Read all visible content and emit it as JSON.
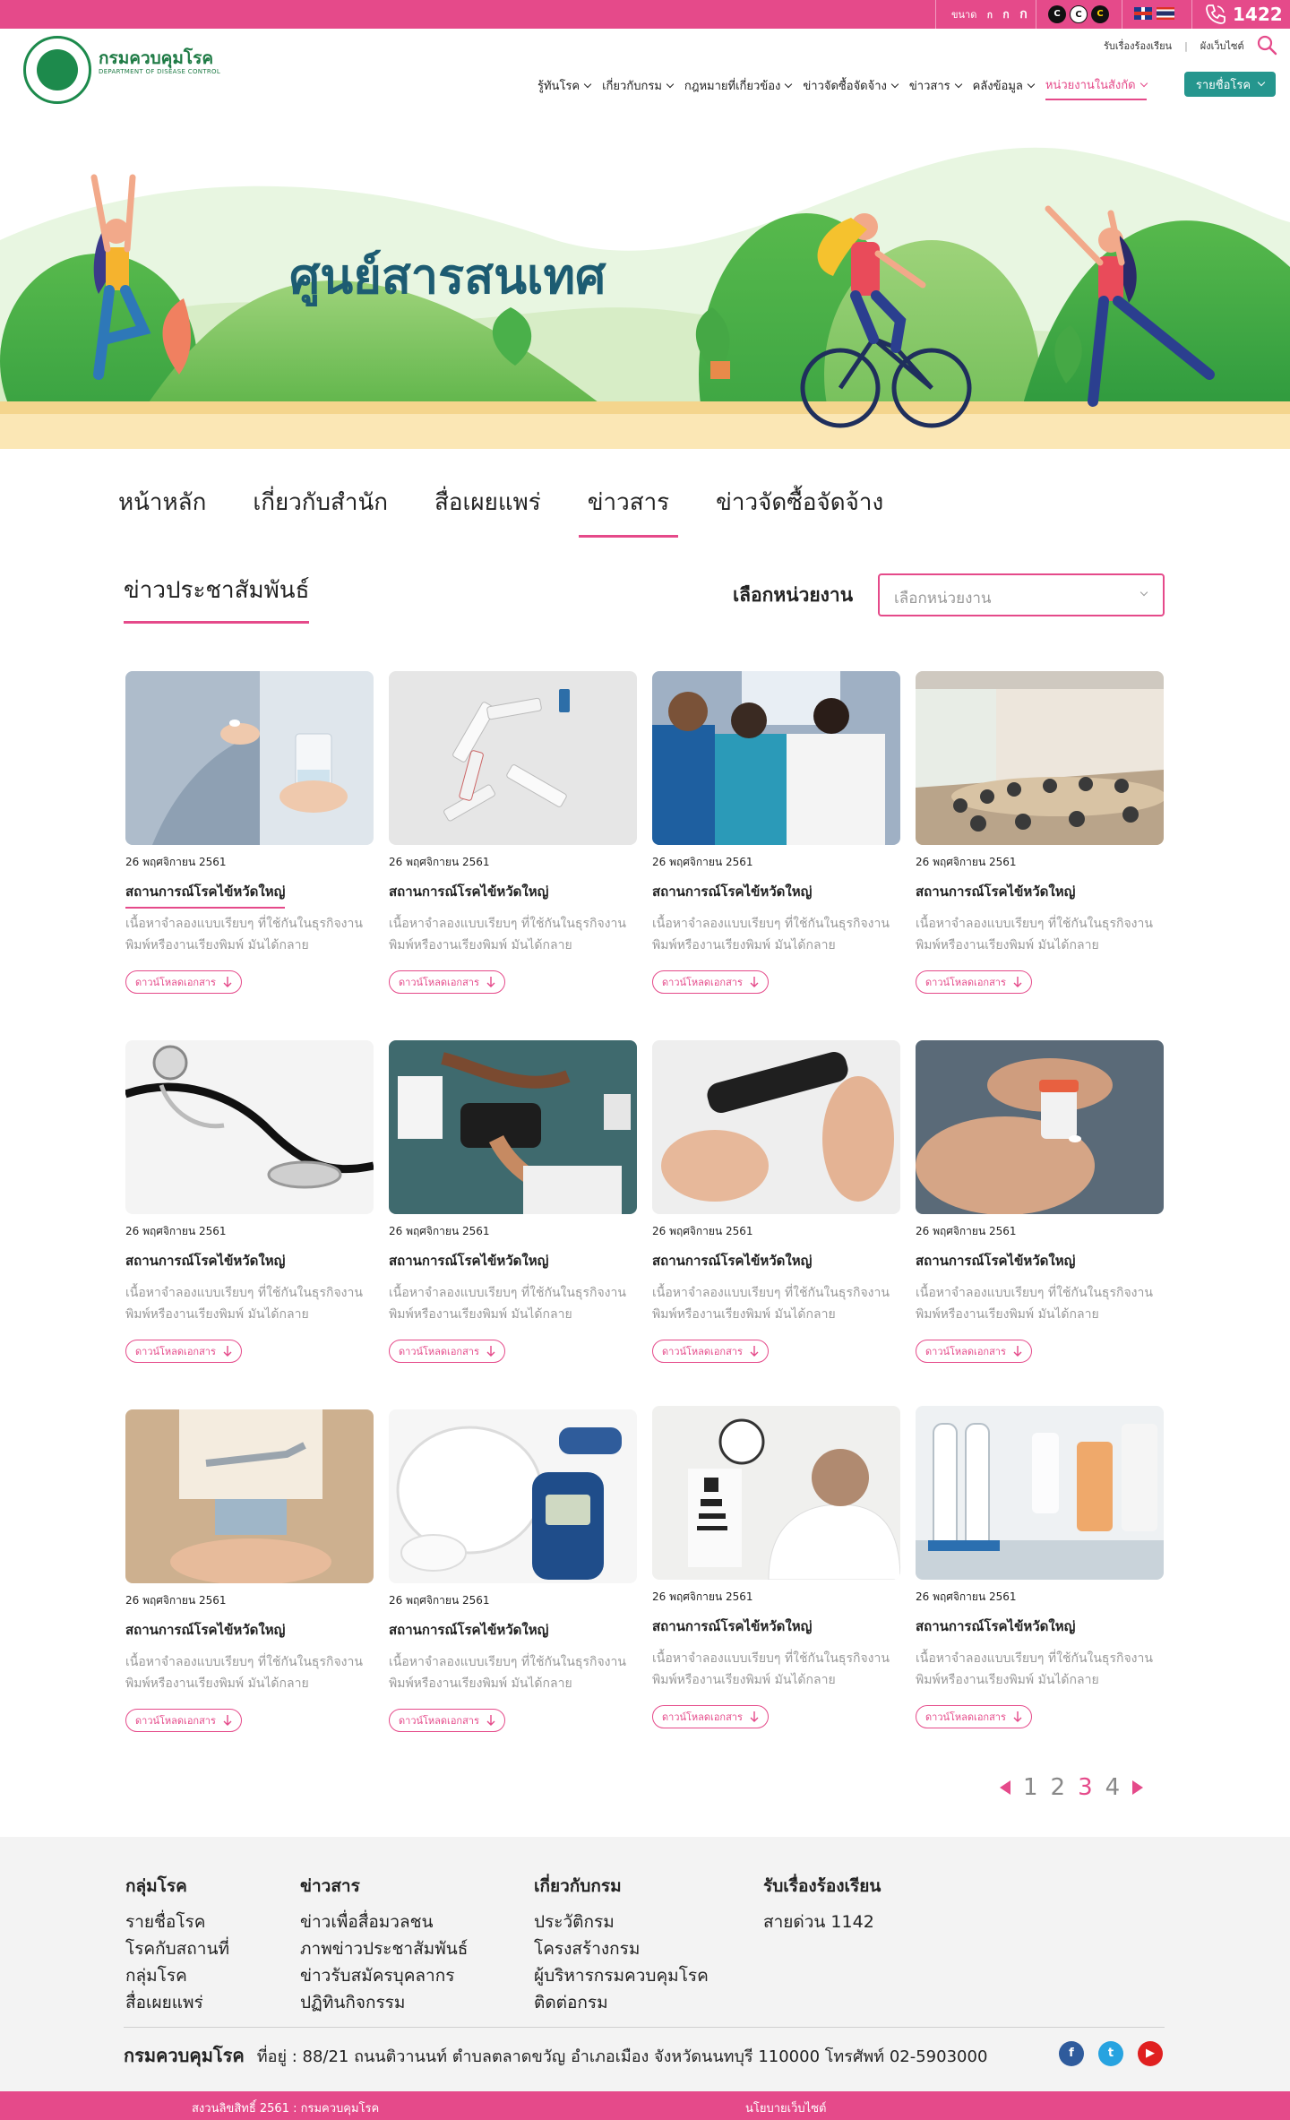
{
  "topbar": {
    "font_size_label": "ขนาด",
    "font_sizes": [
      "ก",
      "ก",
      "ก"
    ],
    "contrast": [
      "C",
      "C",
      "C"
    ],
    "hotline": "1422"
  },
  "header": {
    "logo_name": "กรมควบคุมโรค",
    "logo_sub": "DEPARTMENT OF DISEASE CONTROL",
    "complaint_link": "รับเรื่องร้องเรียน",
    "sitemap_link": "ผังเว็บไซต์",
    "nav": [
      "รู้ทันโรค",
      "เกี่ยวกับกรม",
      "กฎหมายที่เกี่ยวข้อง",
      "ข่าวจัดซื้อจัดจ้าง",
      "ข่าวสาร",
      "คลังข้อมูล",
      "หน่วยงานในสังกัด"
    ],
    "disease_button": "รายชื่อโรค"
  },
  "banner": {
    "title": "ศูนย์สารสนเทศ"
  },
  "tabs": [
    "หน้าหลัก",
    "เกี่ยวกับสำนัก",
    "สื่อเผยแพร่",
    "ข่าวสาร",
    "ข่าวจัดซื้อจัดจ้าง"
  ],
  "section": {
    "title": "ข่าวประชาสัมพันธ์",
    "unit_label": "เลือกหน่วยงาน",
    "unit_placeholder": "เลือกหน่วยงาน"
  },
  "cards": [
    {
      "date": "26 พฤศจิกายน 2561",
      "title": "สถานการณ์โรคไข้หวัดใหญ่",
      "desc": "เนื้อหาจำลองแบบเรียบๆ ที่ใช้กันในธุรกิจงานพิมพ์หรืองานเรียงพิมพ์ มันได้กลาย",
      "download": "ดาวน์โหลดเอกสาร",
      "image": "hand-pill-water-glass"
    },
    {
      "date": "26 พฤศจิกายน 2561",
      "title": "สถานการณ์โรคไข้หวัดใหญ่",
      "desc": "เนื้อหาจำลองแบบเรียบๆ ที่ใช้กันในธุรกิจงานพิมพ์หรืองานเรียงพิมพ์ มันได้กลาย",
      "download": "ดาวน์โหลดเอกสาร",
      "image": "ointment-tubes"
    },
    {
      "date": "26 พฤศจิกายน 2561",
      "title": "สถานการณ์โรคไข้หวัดใหญ่",
      "desc": "เนื้อหาจำลองแบบเรียบๆ ที่ใช้กันในธุรกิจงานพิมพ์หรืองานเรียงพิมพ์ มันได้กลาย",
      "download": "ดาวน์โหลดเอกสาร",
      "image": "doctors-xray"
    },
    {
      "date": "26 พฤศจิกายน 2561",
      "title": "สถานการณ์โรคไข้หวัดใหญ่",
      "desc": "เนื้อหาจำลองแบบเรียบๆ ที่ใช้กันในธุรกิจงานพิมพ์หรืองานเรียงพิมพ์ มันได้กลาย",
      "download": "ดาวน์โหลดเอกสาร",
      "image": "meeting-room"
    },
    {
      "date": "26 พฤศจิกายน 2561",
      "title": "สถานการณ์โรคไข้หวัดใหญ่",
      "desc": "เนื้อหาจำลองแบบเรียบๆ ที่ใช้กันในธุรกิจงานพิมพ์หรืองานเรียงพิมพ์ มันได้กลาย",
      "download": "ดาวน์โหลดเอกสาร",
      "image": "stethoscope"
    },
    {
      "date": "26 พฤศจิกายน 2561",
      "title": "สถานการณ์โรคไข้หวัดใหญ่",
      "desc": "เนื้อหาจำลองแบบเรียบๆ ที่ใช้กันในธุรกิจงานพิมพ์หรืองานเรียงพิมพ์ มันได้กลาย",
      "download": "ดาวน์โหลดเอกสาร",
      "image": "blood-pressure"
    },
    {
      "date": "26 พฤศจิกายน 2561",
      "title": "สถานการณ์โรคไข้หวัดใหญ่",
      "desc": "เนื้อหาจำลองแบบเรียบๆ ที่ใช้กันในธุรกิจงานพิมพ์หรืองานเรียงพิมพ์ มันได้กลาย",
      "download": "ดาวน์โหลดเอกสาร",
      "image": "glucose-pen"
    },
    {
      "date": "26 พฤศจิกายน 2561",
      "title": "สถานการณ์โรคไข้หวัดใหญ่",
      "desc": "เนื้อหาจำลองแบบเรียบๆ ที่ใช้กันในธุรกิจงานพิมพ์หรืองานเรียงพิมพ์ มันได้กลาย",
      "download": "ดาวน์โหลดเอกสาร",
      "image": "pills-in-palm"
    },
    {
      "date": "26 พฤศจิกายน 2561",
      "title": "สถานการณ์โรคไข้หวัดใหญ่",
      "desc": "เนื้อหาจำลองแบบเรียบๆ ที่ใช้กันในธุรกิจงานพิมพ์หรืองานเรียงพิมพ์ มันได้กลาย",
      "download": "ดาวน์โหลดเอกสาร",
      "image": "robot-arm-hand"
    },
    {
      "date": "26 พฤศจิกายน 2561",
      "title": "สถานการณ์โรคไข้หวัดใหญ่",
      "desc": "เนื้อหาจำลองแบบเรียบๆ ที่ใช้กันในธุรกิจงานพิมพ์หรืองานเรียงพิมพ์ มันได้กลาย",
      "download": "ดาวน์โหลดเอกสาร",
      "image": "glucose-meter"
    },
    {
      "date": "26 พฤศจิกายน 2561",
      "title": "สถานการณ์โรคไข้หวัดใหญ่",
      "desc": "เนื้อหาจำลองแบบเรียบๆ ที่ใช้กันในธุรกิจงานพิมพ์หรืองานเรียงพิมพ์ มันได้กลาย",
      "download": "ดาวน์โหลดเอกสาร",
      "image": "eye-chart-doctor"
    },
    {
      "date": "26 พฤศจิกายน 2561",
      "title": "สถานการณ์โรคไข้หวัดใหญ่",
      "desc": "เนื้อหาจำลองแบบเรียบๆ ที่ใช้กันในธุรกิจงานพิมพ์หรืองานเรียงพิมพ์ มันได้กลาย",
      "download": "ดาวน์โหลดเอกสาร",
      "image": "test-tubes"
    }
  ],
  "pagination": {
    "pages": [
      "1",
      "2",
      "3",
      "4"
    ],
    "current": "3"
  },
  "footer": {
    "columns": [
      {
        "heading": "กลุ่มโรค",
        "links": [
          "รายชื่อโรค",
          "โรคกับสถานที่",
          "กลุ่มโรค",
          "สื่อเผยแพร่"
        ]
      },
      {
        "heading": "ข่าวสาร",
        "links": [
          "ข่าวเพื่อสื่อมวลชน",
          "ภาพข่าวประชาสัมพันธ์",
          "ข่าวรับสมัครบุคลากร",
          "ปฏิทินกิจกรรม"
        ]
      },
      {
        "heading": "เกี่ยวกับกรม",
        "links": [
          "ประวัติกรม",
          "โครงสร้างกรม",
          "ผู้บริหารกรมควบคุมโรค",
          "ติดต่อกรม"
        ]
      },
      {
        "heading": "รับเรื่องร้องเรียน",
        "links": [
          "สายด่วน 1142"
        ]
      }
    ],
    "org_name": "กรมควบคุมโรค",
    "address": "ที่อยู่ : 88/21 ถนนติวานนท์ ตำบลตลาดขวัญ อำเภอเมือง จังหวัดนนทบุรี 110000 โทรศัพท์ 02-5903000",
    "social": [
      "f",
      "t",
      "▶"
    ]
  },
  "bottombar": {
    "copyright": "สงวนลิขสิทธิ์ 2561 : กรมควบคุมโรค",
    "policy": "นโยบายเว็บไซต์"
  },
  "colors": {
    "brand_pink": "#e54a8a",
    "brand_teal": "#25968e",
    "logo_green": "#1d8a4c"
  }
}
